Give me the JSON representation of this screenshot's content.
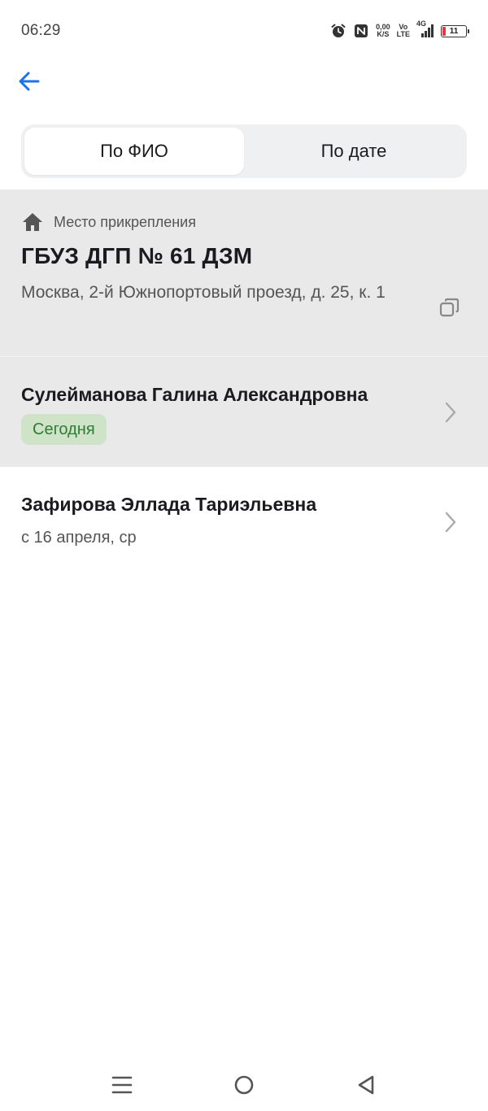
{
  "status_bar": {
    "time": "06:29",
    "net_speed_value": "0,00",
    "net_speed_unit": "K/S",
    "volte_top": "Vo",
    "volte_bottom": "LTE",
    "network": "4G",
    "battery": "11",
    "battery_color": "#e53935"
  },
  "header": {
    "back_icon": "arrow-left-icon",
    "accent_color": "#1a73e8"
  },
  "tabs": [
    {
      "label": "По ФИО",
      "active": true
    },
    {
      "label": "По дате",
      "active": false
    }
  ],
  "attachment": {
    "label": "Место прикрепления",
    "icon": "home-icon",
    "clinic_name": "ГБУЗ ДГП № 61 ДЗМ",
    "address": "Москва, 2-й Южнопортовый проезд, д. 25, к. 1",
    "copy_icon": "copy-icon"
  },
  "doctors": [
    {
      "name": "Сулейманова Галина Александровна",
      "badge": "Сегодня",
      "badge_color": "#2e7d32"
    },
    {
      "name": "Зафирова Эллада Тариэльевна",
      "date": "с 16 апреля, ср"
    }
  ],
  "nav_bar": {
    "menu_icon": "menu-icon",
    "home_icon": "circle-home-icon",
    "back_icon": "triangle-back-icon"
  }
}
